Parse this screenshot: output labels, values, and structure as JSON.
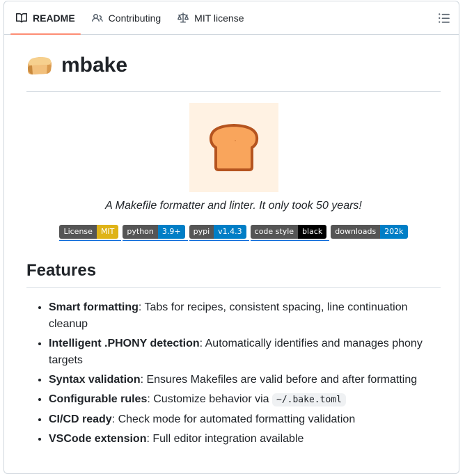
{
  "tabs": [
    {
      "label": "README",
      "icon": "book-icon",
      "active": true
    },
    {
      "label": "Contributing",
      "icon": "people-icon",
      "active": false
    },
    {
      "label": "MIT license",
      "icon": "law-scale-icon",
      "active": false
    }
  ],
  "outline_icon": "list-unordered-icon",
  "title": "mbake",
  "title_emoji": "bread-emoji",
  "tagline": "A Makefile formatter and linter. It only took 50 years!",
  "badges": [
    {
      "left": "License",
      "right": "MIT",
      "color": "#dfb317"
    },
    {
      "left": "python",
      "right": "3.9+",
      "color": "#007ec6"
    },
    {
      "left": "pypi",
      "right": "v1.4.3",
      "color": "#007ec6"
    },
    {
      "left": "code style",
      "right": "black",
      "color": "#000000"
    },
    {
      "left": "downloads",
      "right": "202k",
      "color": "#007ec6"
    }
  ],
  "features_heading": "Features",
  "features": [
    {
      "bold": "Smart formatting",
      "text": ": Tabs for recipes, consistent spacing, line continuation cleanup"
    },
    {
      "bold": "Intelligent .PHONY detection",
      "text": ": Automatically identifies and manages phony targets"
    },
    {
      "bold": "Syntax validation",
      "text": ": Ensures Makefiles are valid before and after formatting"
    },
    {
      "bold": "Configurable rules",
      "text": ": Customize behavior via ",
      "code": "~/.bake.toml"
    },
    {
      "bold": "CI/CD ready",
      "text": ": Check mode for automated formatting validation"
    },
    {
      "bold": "VSCode extension",
      "text": ": Full editor integration available"
    }
  ],
  "colors": {
    "tab_underline": "#fd8c73",
    "logo_bg": "#fff2e3",
    "bread_fill": "#f9a55c",
    "bread_outline": "#b5541f"
  }
}
